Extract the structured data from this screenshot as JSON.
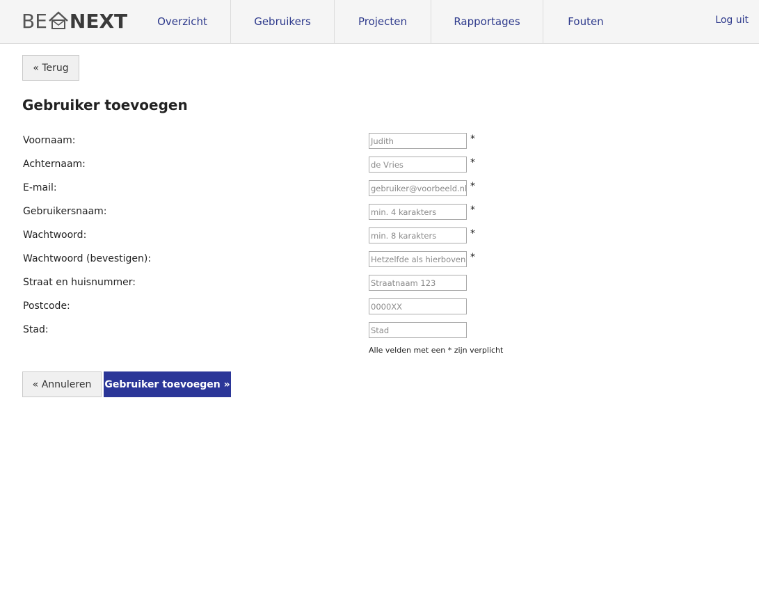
{
  "header": {
    "logo": {
      "left": "BE",
      "right": "NEXT",
      "icon": "house-envelope-icon"
    },
    "nav": [
      {
        "label": "Overzicht"
      },
      {
        "label": "Gebruikers"
      },
      {
        "label": "Projecten"
      },
      {
        "label": "Rapportages"
      },
      {
        "label": "Fouten"
      }
    ],
    "logout_label": "Log uit"
  },
  "back_button": "« Terug",
  "page_title": "Gebruiker toevoegen",
  "form": {
    "fields": [
      {
        "label": "Voornaam:",
        "placeholder": "Judith",
        "required": "*"
      },
      {
        "label": "Achternaam:",
        "placeholder": "de Vries",
        "required": "*"
      },
      {
        "label": "E-mail:",
        "placeholder": "gebruiker@voorbeeld.nl",
        "required": "*"
      },
      {
        "label": "Gebruikersnaam:",
        "placeholder": "min. 4 karakters",
        "required": "*"
      },
      {
        "label": "Wachtwoord:",
        "placeholder": "min. 8 karakters",
        "required": "*"
      },
      {
        "label": "Wachtwoord (bevestigen):",
        "placeholder": "Hetzelfde als hierboven",
        "required": "*"
      },
      {
        "label": "Straat en huisnummer:",
        "placeholder": "Straatnaam 123",
        "required": ""
      },
      {
        "label": "Postcode:",
        "placeholder": "0000XX",
        "required": ""
      },
      {
        "label": "Stad:",
        "placeholder": "Stad",
        "required": ""
      }
    ],
    "required_note": "Alle velden met een * zijn verplicht",
    "cancel_label": "« Annuleren",
    "submit_label": "Gebruiker toevoegen »"
  },
  "colors": {
    "primary": "#2b3698",
    "nav_text": "#2e3a8c",
    "header_bg": "#f5f5f5"
  }
}
